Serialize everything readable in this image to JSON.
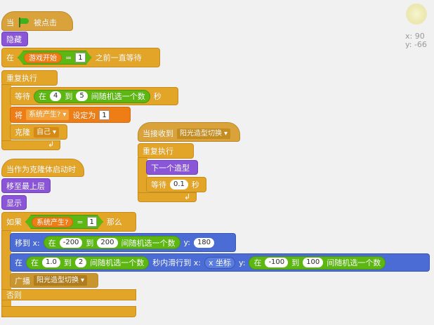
{
  "scripts": {
    "s1": {
      "hat_when": "当",
      "hat_clicked": "被点击",
      "hide": "隐藏",
      "wait_until_at": "在",
      "game_start_var": "游戏开始",
      "eq": "=",
      "wait_value": "1",
      "wait_until_suffix": "之前一直等待",
      "forever": "重复执行",
      "wait_label": "等待",
      "rand_at": "在",
      "rand_min": "4",
      "rand_to": "到",
      "rand_max": "5",
      "rand_suffix": "间随机选一个数",
      "seconds": "秒",
      "set_label": "将",
      "set_var": "系统产生?",
      "set_to": "设定为",
      "set_value": "1",
      "clone_label": "克隆",
      "clone_target": "自己"
    },
    "s2": {
      "hat_label": "当接收到",
      "message": "阳光造型切换",
      "forever": "重复执行",
      "next_costume": "下一个造型",
      "wait_label": "等待",
      "wait_value": "0.1",
      "seconds": "秒"
    },
    "s3": {
      "hat_label": "当作为克隆体启动时",
      "go_front": "移至最上层",
      "show": "显示",
      "if_label": "如果",
      "cond_var": "系统产生?",
      "eq": "=",
      "cond_value": "1",
      "then_label": "那么",
      "goto_label": "移到 x:",
      "goto_at": "在",
      "goto_xmin": "-200",
      "goto_to": "到",
      "goto_xmax": "200",
      "goto_suffix": "间随机选一个数",
      "goto_y_label": "y:",
      "goto_y": "180",
      "glide_at": "在",
      "glide_inner_at": "在",
      "glide_tmin": "1.0",
      "glide_to": "到",
      "glide_tmax": "2",
      "glide_suffix": "间随机选一个数",
      "glide_mid": "秒内滑行到 x:",
      "glide_xpos_label": "x 坐标",
      "glide_y_label": "y:",
      "glide_y_at": "在",
      "glide_ymin": "-100",
      "glide_y_to": "到",
      "glide_ymax": "100",
      "glide_y_suffix": "间随机选一个数",
      "broadcast_label": "广播",
      "broadcast_msg": "阳光造型切换",
      "else_label": "否则"
    }
  },
  "coords": {
    "x": "x: 90",
    "y": "y: -66"
  },
  "colors": {
    "events": "#d9a23a",
    "control": "#e3a528",
    "looks": "#8a55d7",
    "motion": "#4a6cd4",
    "operators": "#5cb712",
    "data": "#ee7d16",
    "canvas": "#f1f1f1"
  }
}
